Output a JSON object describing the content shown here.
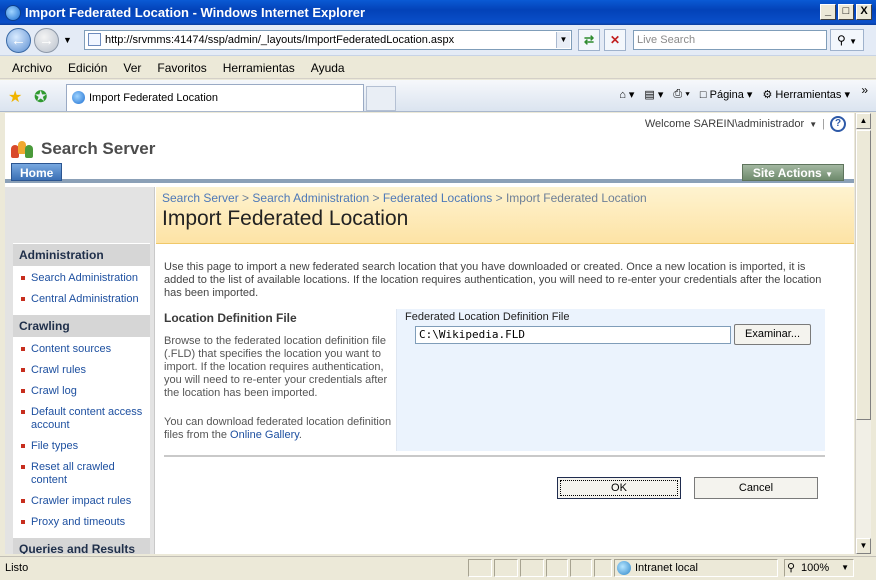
{
  "window": {
    "title": "Import Federated Location - Windows Internet Explorer",
    "controls": [
      "_",
      "□",
      "X"
    ]
  },
  "address_bar": {
    "url": "http://srvmms:41474/ssp/admin/_layouts/ImportFederatedLocation.aspx",
    "search_placeholder": "Live Search"
  },
  "menu": [
    "Archivo",
    "Edición",
    "Ver",
    "Favoritos",
    "Herramientas",
    "Ayuda"
  ],
  "tabs": {
    "active_label": "Import Federated Location"
  },
  "command_bar": {
    "page_label": "Página",
    "tools_label": "Herramientas"
  },
  "site": {
    "welcome": "Welcome SAREIN\\administrador",
    "title": "Search Server",
    "home_tab": "Home",
    "site_actions": "Site Actions"
  },
  "left_nav": {
    "sections": [
      {
        "heading": "Administration",
        "items": [
          "Search Administration",
          "Central Administration"
        ]
      },
      {
        "heading": "Crawling",
        "items": [
          "Content sources",
          "Crawl rules",
          "Crawl log",
          "Default content access account",
          "File types",
          "Reset all crawled content",
          "Crawler impact rules",
          "Proxy and timeouts"
        ]
      },
      {
        "heading": "Queries and Results",
        "items": []
      }
    ]
  },
  "breadcrumb": {
    "items": [
      "Search Server",
      "Search Administration",
      "Federated Locations",
      "Import Federated Location"
    ],
    "separator": ">"
  },
  "page": {
    "title": "Import Federated Location",
    "intro": "Use this page to import a new federated search location that you have downloaded or created. Once a new location is imported, it is added to the list of available locations. If the location requires authentication, you will need to re-enter your credentials after the location has been imported."
  },
  "section": {
    "title": "Location Definition File",
    "description": "Browse to the federated location definition file (.FLD) that specifies the location you want to import. If the location requires authentication, you will need to re-enter your credentials after the location has been imported.",
    "download_prefix": "You can download federated location definition files from the ",
    "download_link": "Online Gallery",
    "download_suffix": ".",
    "field_label": "Federated Location Definition File",
    "file_value": "C:\\Wikipedia.FLD",
    "browse_label": "Examinar..."
  },
  "buttons": {
    "ok": "OK",
    "cancel": "Cancel"
  },
  "status_bar": {
    "status": "Listo",
    "zone": "Intranet local",
    "zoom": "100%"
  },
  "colors": {
    "titlebar": "#0342b8",
    "nav_link": "#1e50a0",
    "title_area": "#fde3a5",
    "left_nav_bg": "#e3e3e3"
  }
}
